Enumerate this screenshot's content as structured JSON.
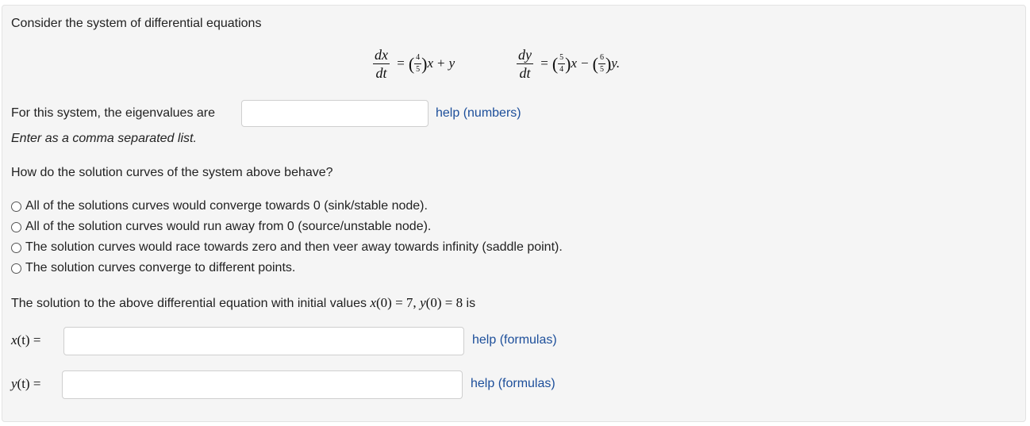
{
  "intro": "Consider the system of differential equations",
  "equations": {
    "eq1": {
      "num": "dx",
      "den": "dt",
      "frac_num": "4",
      "frac_den": "5",
      "rest_x": "x",
      "plus": "+",
      "rest_y": "y"
    },
    "eq2": {
      "num": "dy",
      "den": "dt",
      "frac1_num": "5",
      "frac1_den": "4",
      "x": "x",
      "minus": "−",
      "frac2_num": "6",
      "frac2_den": "5",
      "y": "y."
    }
  },
  "eigen": {
    "prompt": "For this system, the eigenvalues are",
    "value": "",
    "help_label": "help (numbers)",
    "hint": "Enter as a comma separated list."
  },
  "behavior": {
    "question": "How do the solution curves of the system above behave?",
    "options": [
      "All of the solutions curves would converge towards 0 (sink/stable node).",
      "All of the solution curves would run away from 0 (source/unstable node).",
      "The solution curves would race towards zero and then veer away towards infinity (saddle point).",
      "The solution curves converge to different points."
    ]
  },
  "solution": {
    "text_before": "The solution to the above differential equation with initial values",
    "ic_x": "x",
    "ic_x_val": "(0) = 7,",
    "ic_y": "y",
    "ic_y_val": "(0) = 8",
    "text_after": "is",
    "x_label_var": "x",
    "x_label_rest": "(t) =",
    "y_label_var": "y",
    "y_label_rest": "(t) =",
    "x_value": "",
    "y_value": "",
    "help_label": "help (formulas)"
  }
}
